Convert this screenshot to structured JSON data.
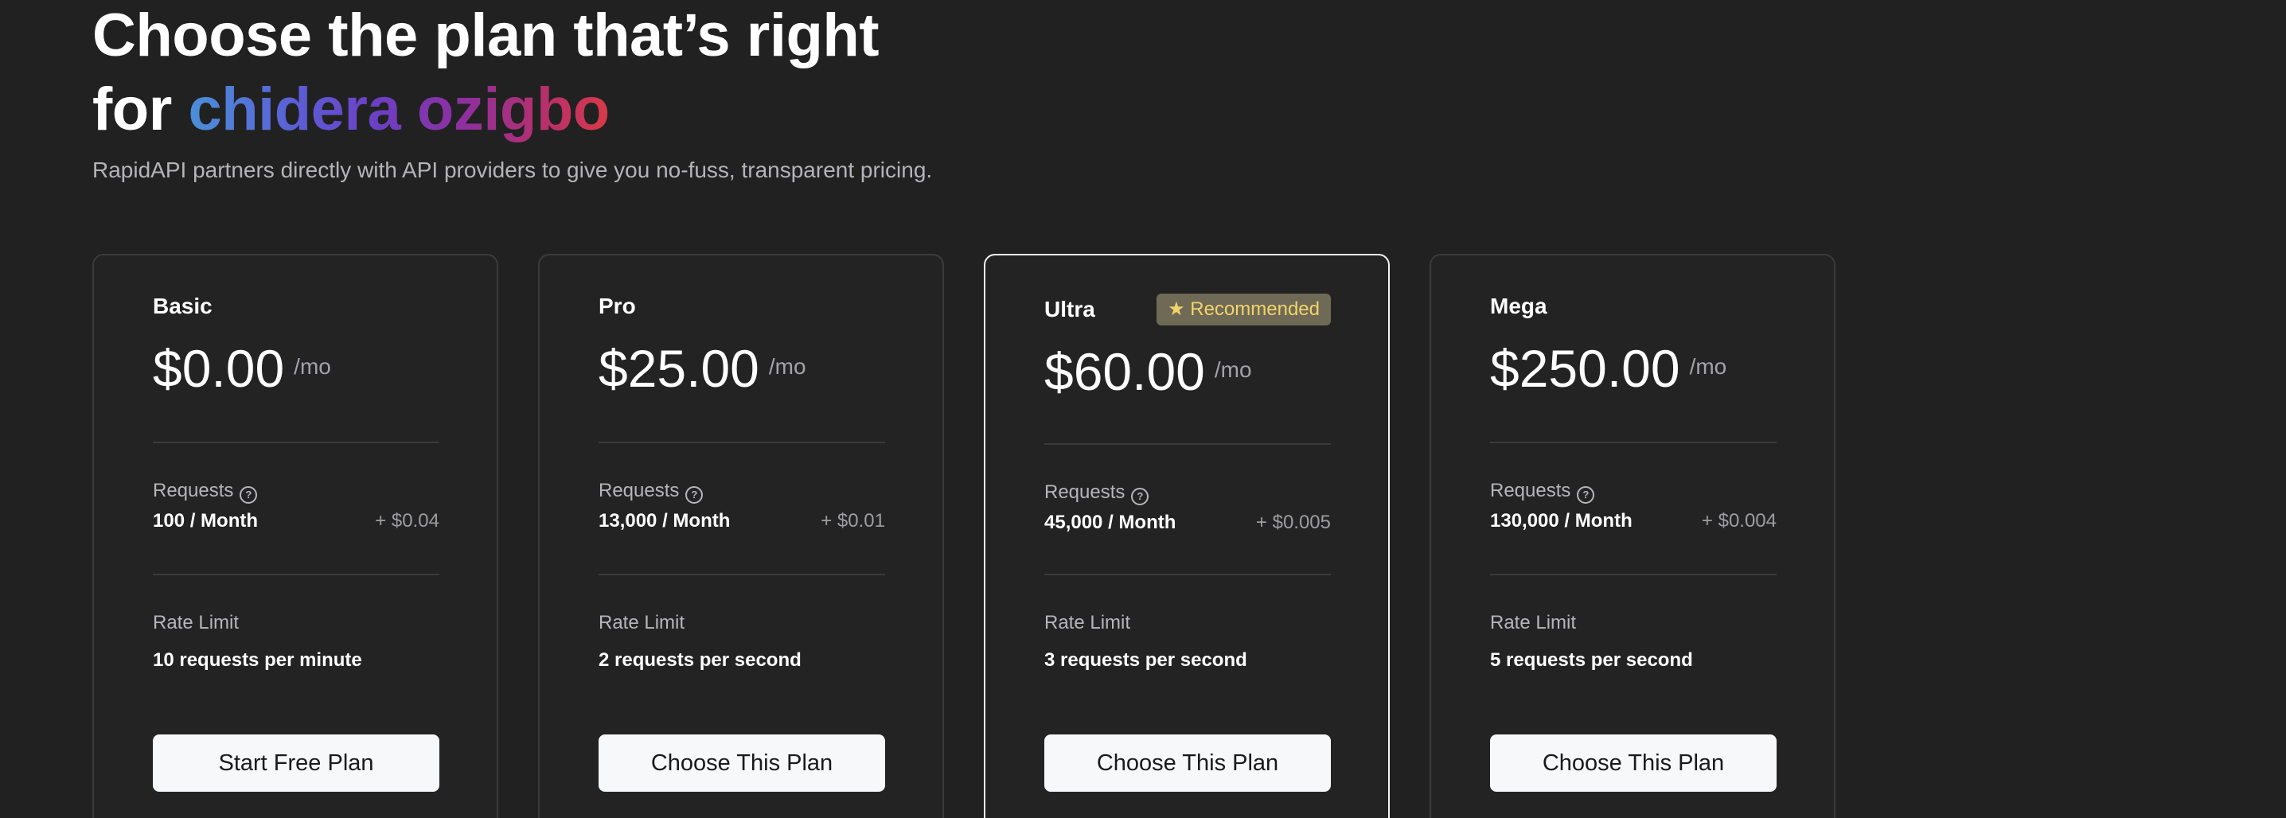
{
  "header": {
    "title_line1": "Choose the plan that’s right",
    "title_for": "for ",
    "user_name": "chidera ozigbo",
    "subtitle": "RapidAPI partners directly with API providers to give you no-fuss, transparent pricing."
  },
  "plans": [
    {
      "name": "Basic",
      "price": "$0.00",
      "period": "/mo",
      "requests_label": "Requests",
      "requests_value": "100 / Month",
      "overage": "+ $0.04",
      "rate_limit_label": "Rate Limit",
      "rate_limit_value": "10 requests per minute",
      "cta": "Start Free Plan"
    },
    {
      "name": "Pro",
      "price": "$25.00",
      "period": "/mo",
      "requests_label": "Requests",
      "requests_value": "13,000 / Month",
      "overage": "+ $0.01",
      "rate_limit_label": "Rate Limit",
      "rate_limit_value": "2 requests per second",
      "cta": "Choose This Plan"
    },
    {
      "name": "Ultra",
      "badge": "Recommended",
      "price": "$60.00",
      "period": "/mo",
      "requests_label": "Requests",
      "requests_value": "45,000 / Month",
      "overage": "+ $0.005",
      "rate_limit_label": "Rate Limit",
      "rate_limit_value": "3 requests per second",
      "cta": "Choose This Plan"
    },
    {
      "name": "Mega",
      "price": "$250.00",
      "period": "/mo",
      "requests_label": "Requests",
      "requests_value": "130,000 / Month",
      "overage": "+ $0.004",
      "rate_limit_label": "Rate Limit",
      "rate_limit_value": "5 requests per second",
      "cta": "Choose This Plan"
    }
  ],
  "colors": {
    "background": "#212121",
    "card_border": "#3b3b3d",
    "recommended_border": "#f2f2f2",
    "badge_background": "#6e6a55",
    "badge_text": "#f3d36b",
    "button_background": "#f7f8fa"
  }
}
